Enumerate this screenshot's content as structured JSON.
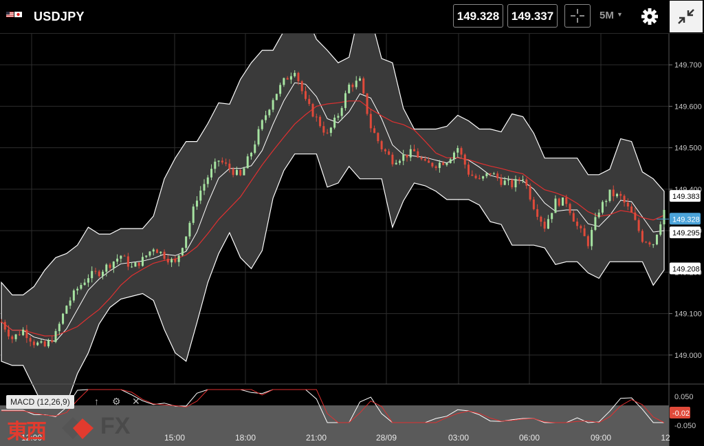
{
  "header": {
    "symbol": "USDJPY",
    "bid": "149.328",
    "ask": "149.337",
    "timeframe": "5M",
    "icons": [
      "us-flag-icon",
      "jp-flag-icon",
      "crosshair-icon",
      "caret-down-icon",
      "gear-icon",
      "collapse-icon"
    ]
  },
  "colors": {
    "background": "#000000",
    "candle_up": "#a6e3a1",
    "candle_down": "#e04a3a",
    "band_fill": "#3a3a3a",
    "band_line": "#ffffff",
    "ma_red": "#e03030",
    "current_price_badge": "#4ba3d9",
    "logo_red": "#e23b2e"
  },
  "price_axis": {
    "ticks": [
      "149.700",
      "149.600",
      "149.500",
      "149.400",
      "149.300",
      "149.200",
      "149.100",
      "149.000"
    ],
    "tags": [
      {
        "value": "149.383",
        "style": "plain"
      },
      {
        "value": "149.328",
        "style": "current"
      },
      {
        "value": "149.295",
        "style": "plain"
      },
      {
        "value": "149.208",
        "style": "plain"
      }
    ]
  },
  "time_axis": {
    "labels": [
      "12:00",
      "15:00",
      "18:00",
      "21:00",
      "28/09",
      "03:00",
      "06:00",
      "09:00",
      "12"
    ]
  },
  "macd": {
    "label": "MACD (12,26,9)",
    "ticks": [
      "0.050",
      "-0.050"
    ],
    "last_value": "-0.02",
    "controls": [
      "arrow-up-icon",
      "gear-icon",
      "close-icon"
    ]
  },
  "logo": {
    "kanji": "東西",
    "fx": "FX"
  },
  "chart_data": {
    "type": "line",
    "series": [
      {
        "values": [
          149.08,
          149.04,
          149.06,
          149.03,
          149.02,
          149.05,
          149.12,
          149.16,
          149.19,
          149.2,
          149.22,
          149.24,
          149.21,
          149.23,
          149.26,
          149.24,
          149.22,
          149.29,
          149.38,
          149.43,
          149.47,
          149.45,
          149.43,
          149.49,
          149.56,
          149.62,
          149.66,
          149.69,
          149.61,
          149.57,
          149.53,
          149.58,
          149.65,
          149.66,
          149.55,
          149.5,
          149.47,
          149.48,
          149.49,
          149.46,
          149.46,
          149.47,
          149.5,
          149.44,
          149.42,
          149.44,
          149.42,
          149.41,
          149.43,
          149.36,
          149.31,
          149.37,
          149.37,
          149.31,
          149.27,
          149.35,
          149.39,
          149.38,
          149.34,
          149.28,
          149.27,
          149.35
        ]
      }
    ],
    "ylim": [
      148.93,
      149.775
    ]
  }
}
